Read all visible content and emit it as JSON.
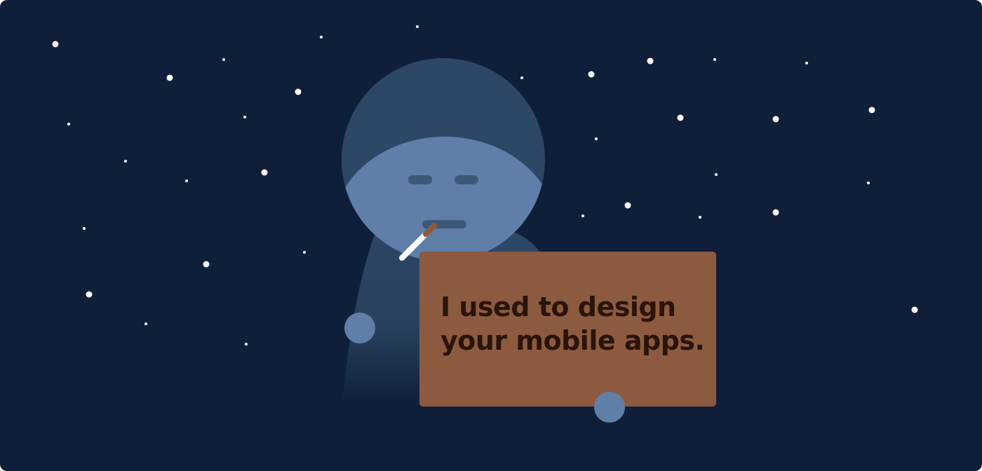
{
  "sign": {
    "line1": "I used to design",
    "line2": "your mobile apps."
  },
  "colors": {
    "background": "#0f1f3a",
    "star": "#ffffff",
    "head_top": "#2d4766",
    "face": "#5f7fa8",
    "body": "#2d4766",
    "feature": "#3e5878",
    "sign_board": "#8c5b3f",
    "sign_text": "#2a140a",
    "hand": "#5f7fa8",
    "cigarette": "#ffffff",
    "cigarette_filter": "#8c5b3f"
  },
  "icons": {
    "figure": "homeless-person-illustration",
    "cigarette": "cigarette-icon",
    "stars": "star-dots"
  }
}
